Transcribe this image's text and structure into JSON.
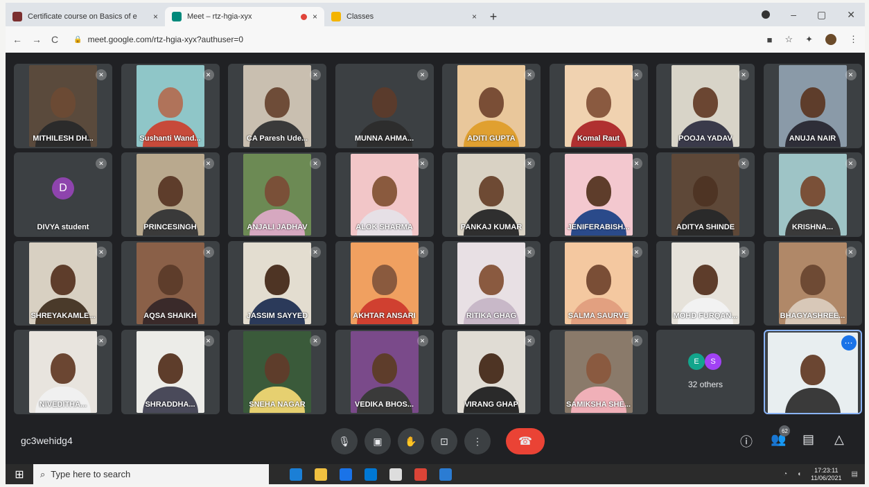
{
  "browser": {
    "tabs": [
      {
        "title": "Certificate course on Basics of e",
        "favicon_color": "#7b2f2f",
        "recording": false
      },
      {
        "title": "Meet – rtz-hgia-xyx",
        "favicon_color": "#00897b",
        "recording": true
      },
      {
        "title": "Classes",
        "favicon_color": "#f4b400",
        "recording": false
      }
    ],
    "close_glyph": "×",
    "new_tab_glyph": "+",
    "url": "meet.google.com/rtz-hgia-xyx?authuser=0",
    "nav": {
      "back": "←",
      "forward": "→",
      "reload": "C"
    }
  },
  "participants": [
    {
      "name": "MITHILESH DH...",
      "bg": "#5a4a3c",
      "skin": "#6b4a34",
      "shirt": "#2b2b2b"
    },
    {
      "name": "Sushanti Wand...",
      "bg": "#8fc6c8",
      "skin": "#b0735a",
      "shirt": "#c74a3a"
    },
    {
      "name": "CA Paresh Ude...",
      "bg": "#c9bfb0",
      "skin": "#6e4c38",
      "shirt": "#3a3a3a"
    },
    {
      "name": "MUNNA AHMA...",
      "bg": "#3c4043",
      "skin": "#5a3b2c",
      "shirt": "#2d2d2d"
    },
    {
      "name": "ADITI GUPTA",
      "bg": "#e9c79b",
      "skin": "#7a4e36",
      "shirt": "#e0a030"
    },
    {
      "name": "Komal Raut",
      "bg": "#f0d2b0",
      "skin": "#8a5a40",
      "shirt": "#b03030"
    },
    {
      "name": "POOJA YADAV",
      "bg": "#d8d4c8",
      "skin": "#6b4632",
      "shirt": "#3a3a4a"
    },
    {
      "name": "ANUJA NAIR",
      "bg": "#8a9aa8",
      "skin": "#5e3d2b",
      "shirt": "#2e2e38"
    },
    {
      "name": "DIVYA student",
      "letter": "D"
    },
    {
      "name": "PRINCESINGH",
      "bg": "#b9a98e",
      "skin": "#5e3d2b",
      "shirt": "#3a3a3a"
    },
    {
      "name": "ANJALI JADHAV",
      "bg": "#6c8a54",
      "skin": "#7a5038",
      "shirt": "#d6a8c0"
    },
    {
      "name": "ALOK SHARMA",
      "bg": "#f2c6c8",
      "skin": "#8a5a3e",
      "shirt": "#e6e0e6"
    },
    {
      "name": "PANKAJ KUMAR",
      "bg": "#d9d2c4",
      "skin": "#6e4a34",
      "shirt": "#2f2f2f"
    },
    {
      "name": "JENIFERABISH...",
      "bg": "#f3c8cf",
      "skin": "#5e3d2b",
      "shirt": "#2a4a8a"
    },
    {
      "name": "ADITYA SHINDE",
      "bg": "#5e4838",
      "skin": "#4e3424",
      "shirt": "#2a2a2a"
    },
    {
      "name": "KRISHNA...",
      "bg": "#9ec4c6",
      "skin": "#7a5038",
      "shirt": "#3a3a3a"
    },
    {
      "name": "SHREYAKAMLE...",
      "bg": "#d8d0c2",
      "skin": "#5e3d2b",
      "shirt": "#4a3a2a"
    },
    {
      "name": "AQSA SHAIKH",
      "bg": "#8a6048",
      "skin": "#5e3d2b",
      "shirt": "#3a2a2a"
    },
    {
      "name": "JASSIM SAYYED",
      "bg": "#e3ddd0",
      "skin": "#4e3424",
      "shirt": "#2b3a5a"
    },
    {
      "name": "AKHTAR ANSARI",
      "bg": "#f0a060",
      "skin": "#8a5a3e",
      "shirt": "#d04030"
    },
    {
      "name": "RITIKA GHAG",
      "bg": "#e8e0e4",
      "skin": "#8a5a40",
      "shirt": "#c8b8c8"
    },
    {
      "name": "SALMA SAURVE",
      "bg": "#f4c8a0",
      "skin": "#7a4e36",
      "shirt": "#e2a080"
    },
    {
      "name": "MOHD FURQAN...",
      "bg": "#e6e2da",
      "skin": "#5e3d2b",
      "shirt": "#f2f2f2"
    },
    {
      "name": "BHAGYASHREE...",
      "bg": "#b08868",
      "skin": "#6e4a34",
      "shirt": "#d8c8b8"
    },
    {
      "name": "NIVEDITHA...",
      "bg": "#e8e4de",
      "skin": "#6b4632",
      "shirt": "#f0f0f0"
    },
    {
      "name": "SHRADDHA...",
      "bg": "#ecece8",
      "skin": "#5e3d2b",
      "shirt": "#4a4a5a"
    },
    {
      "name": "SNEHA NAGAR",
      "bg": "#3a5a3a",
      "skin": "#5e3d2b",
      "shirt": "#e6d070"
    },
    {
      "name": "VEDIKA BHOS...",
      "bg": "#7a4a8a",
      "skin": "#5e3d2b",
      "shirt": "#3a3a3a"
    },
    {
      "name": "VIRANG GHAP",
      "bg": "#e0dcd4",
      "skin": "#4e3424",
      "shirt": "#2a2a2a"
    },
    {
      "name": "SAMIKSHA SHE...",
      "bg": "#8a7a6a",
      "skin": "#8a5a40",
      "shirt": "#f0b0b8"
    }
  ],
  "others": {
    "label": "32 others",
    "avatars": [
      {
        "letter": "E",
        "color": "#12a58c"
      },
      {
        "letter": "S",
        "color": "#a142f4"
      }
    ]
  },
  "self_tile": {
    "bg": "#e8eef0",
    "skin": "#6b4632",
    "shirt": "#3a3a3a",
    "more_glyph": "⋯"
  },
  "mic_off_glyph": "✕",
  "controls": {
    "meeting_code": "gc3wehidg4",
    "mic": "🎙",
    "camera": "▣",
    "hand": "✋",
    "present": "⊡",
    "more": "⋮",
    "end_call": "☎",
    "info": "ⓘ",
    "people": "👥",
    "people_count": "62",
    "chat": "▤",
    "activities": "△"
  },
  "taskbar": {
    "start": "⊞",
    "search_icon": "⌕",
    "search_placeholder": "Type here to search",
    "apps": [
      "#1b7fd6",
      "#f0c040",
      "#1a73e8",
      "#0078d4",
      "#dddddd",
      "#db4437",
      "#2b7cd3"
    ],
    "time": "17:23:11",
    "date": "11/06/2021"
  }
}
